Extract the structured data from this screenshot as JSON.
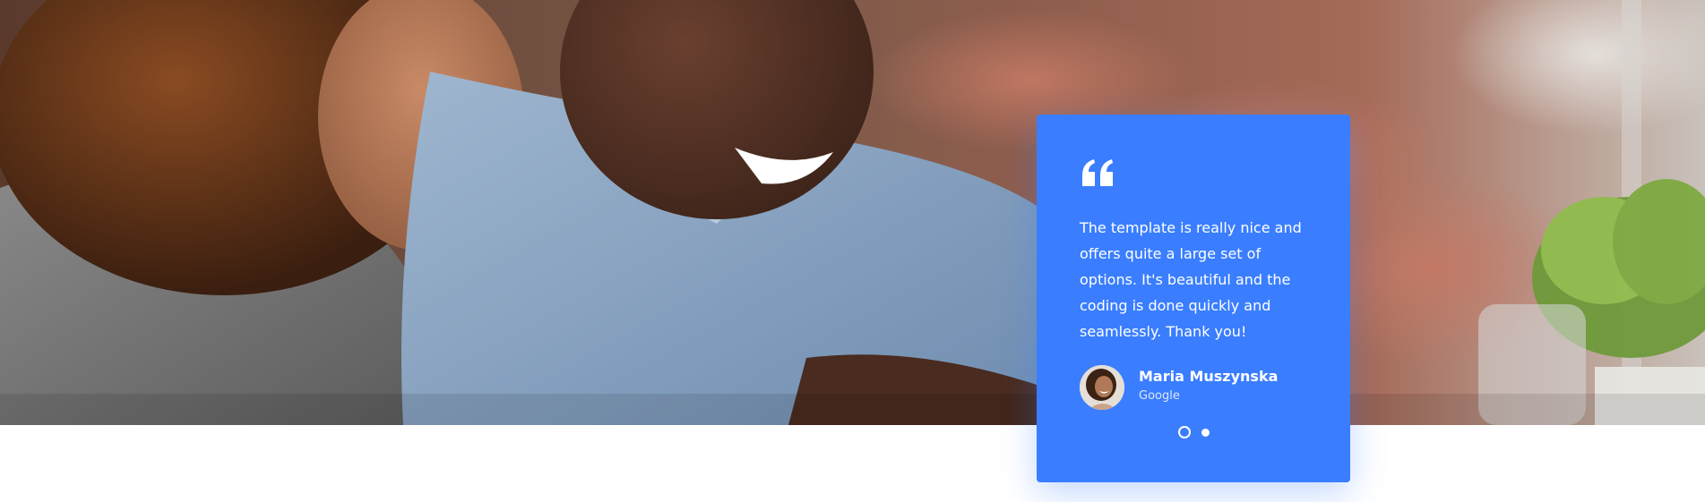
{
  "hero": {
    "image_icon": "people-at-laptop-photo"
  },
  "testimonial": {
    "quote_icon": "quote-icon",
    "text": "The template is really nice and offers quite a large set of options. It's beautiful and the coding is done quickly and seamlessly. Thank you!",
    "author": {
      "name": "Maria Muszynska",
      "company": "Google",
      "avatar_icon": "avatar-photo"
    },
    "pagination": {
      "total": 2,
      "active_index": 0
    }
  },
  "colors": {
    "card_background": "#3a7eff",
    "text": "#ffffff",
    "page_background": "#ffffff"
  }
}
